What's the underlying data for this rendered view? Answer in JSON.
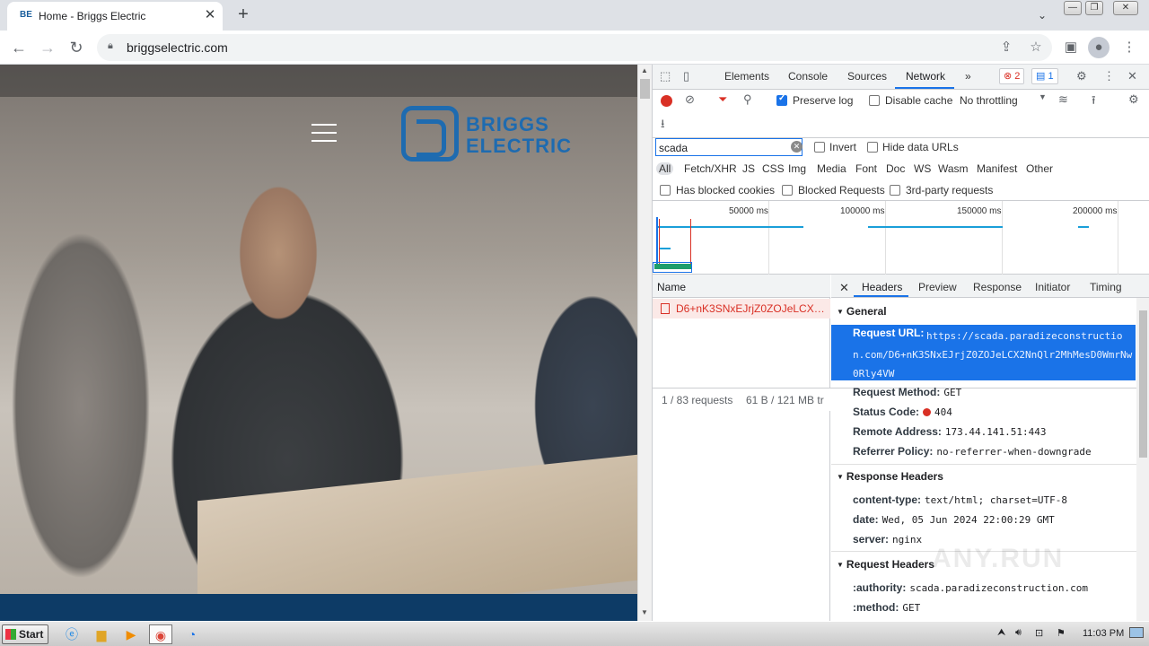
{
  "browser": {
    "tab_title": "Home - Briggs Electric",
    "tab_favicon": "BE",
    "url": "briggselectric.com",
    "window_buttons": [
      "—",
      "❐",
      "✕"
    ]
  },
  "site": {
    "logo_line1": "BRIGGS",
    "logo_line2": "ELECTRIC",
    "brand_color": "#1e6bb0",
    "footer_color": "#0d3b66"
  },
  "devtools": {
    "tabs": [
      "Elements",
      "Console",
      "Sources",
      "Network"
    ],
    "more_tabs": "»",
    "error_count": "2",
    "message_count": "1",
    "preserve_log": "Preserve log",
    "disable_cache": "Disable cache",
    "throttling": "No throttling",
    "filter_value": "scada",
    "invert": "Invert",
    "hide_data_urls": "Hide data URLs",
    "filter_types": [
      "All",
      "Fetch/XHR",
      "JS",
      "CSS",
      "Img",
      "Media",
      "Font",
      "Doc",
      "WS",
      "Wasm",
      "Manifest",
      "Other"
    ],
    "has_blocked_cookies": "Has blocked cookies",
    "blocked_requests": "Blocked Requests",
    "third_party": "3rd-party requests",
    "overview_ticks": [
      "50000 ms",
      "100000 ms",
      "150000 ms",
      "200000 ms"
    ],
    "name_header": "Name",
    "request_name": "D6+nK3SNxEJrjZ0ZOJeLCX2N...",
    "status_requests": "1 / 83 requests",
    "status_size": "61 B / 121 MB tr",
    "detail_tabs": [
      "Headers",
      "Preview",
      "Response",
      "Initiator",
      "Timing"
    ],
    "general": {
      "title": "General",
      "request_url_label": "Request URL:",
      "request_url": "https://scada.paradizeconstruction.com/D6+nK3SNxEJrjZ0ZOJeLCX2NnQlr2MhMesD0WmrNw0Rly4VW",
      "method_label": "Request Method:",
      "method": "GET",
      "status_label": "Status Code:",
      "status": "404",
      "remote_label": "Remote Address:",
      "remote": "173.44.141.51:443",
      "referrer_label": "Referrer Policy:",
      "referrer": "no-referrer-when-downgrade"
    },
    "response_headers": {
      "title": "Response Headers",
      "content_type_label": "content-type:",
      "content_type": "text/html; charset=UTF-8",
      "date_label": "date:",
      "date": "Wed, 05 Jun 2024 22:00:29 GMT",
      "server_label": "server:",
      "server": "nginx"
    },
    "request_headers": {
      "title": "Request Headers",
      "authority_label": ":authority:",
      "authority": "scada.paradizeconstruction.com",
      "method_label": ":method:",
      "method": "GET"
    },
    "watermark": "ANY.RUN"
  },
  "taskbar": {
    "start": "Start",
    "clock": "11:03 PM"
  }
}
